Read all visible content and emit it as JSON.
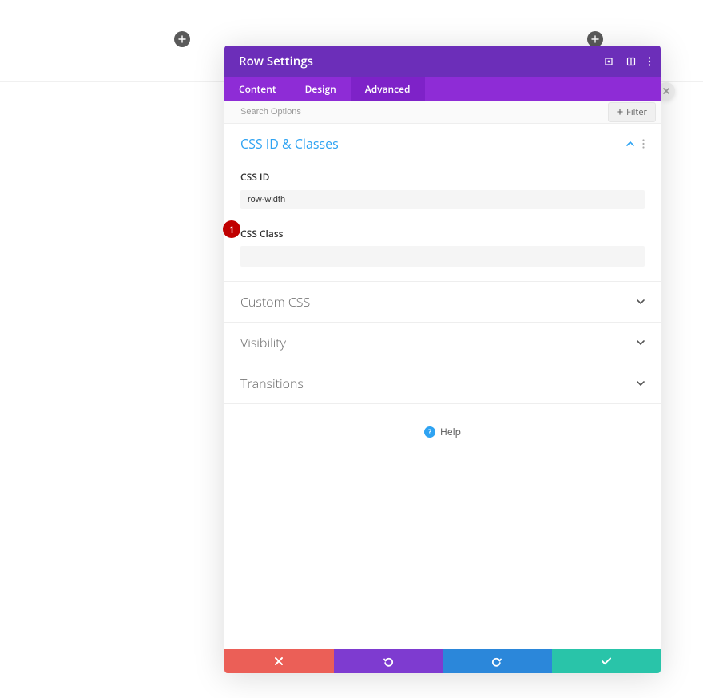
{
  "header": {
    "title": "Row Settings"
  },
  "tabs": {
    "content": "Content",
    "design": "Design",
    "advanced": "Advanced",
    "active": "advanced"
  },
  "search": {
    "placeholder": "Search Options",
    "filter_label": "Filter"
  },
  "sections": [
    {
      "key": "css_id_classes",
      "title": "CSS ID & Classes",
      "open": true,
      "fields": {
        "css_id": {
          "label": "CSS ID",
          "value": "row-width"
        },
        "css_class": {
          "label": "CSS Class",
          "value": ""
        }
      }
    },
    {
      "key": "custom_css",
      "title": "Custom CSS",
      "open": false
    },
    {
      "key": "visibility",
      "title": "Visibility",
      "open": false
    },
    {
      "key": "transitions",
      "title": "Transitions",
      "open": false
    }
  ],
  "help": {
    "label": "Help"
  },
  "annotation": {
    "number": "1"
  }
}
